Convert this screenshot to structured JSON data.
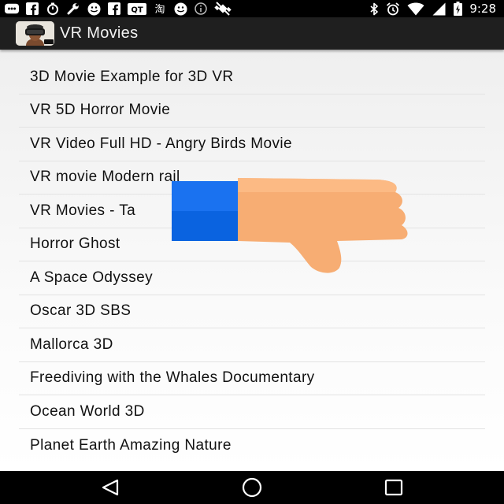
{
  "status_bar": {
    "time": "9:28",
    "left_icons": [
      "chat-icon",
      "facebook-icon",
      "stopwatch-icon",
      "wrench-icon",
      "smiley-icon",
      "facebook-icon",
      "qt-icon",
      "taobao-icon",
      "smiley-icon",
      "info-icon",
      "no-satellite-icon"
    ],
    "right_icons": [
      "bluetooth-icon",
      "alarm-icon",
      "wifi-icon",
      "signal-icon",
      "battery-charging-icon"
    ],
    "left_labels": {
      "qt": "QT",
      "taobao": "淘"
    }
  },
  "app_bar": {
    "title": "VR Movies",
    "icon": "vr-headset-app-icon"
  },
  "movies": [
    "3D Movie Example for 3D VR",
    "VR 5D Horror Movie",
    "VR Video Full HD - Angry Birds Movie",
    "VR movie Modern rail",
    "VR Movies - Ta",
    "Horror Ghost",
    "A Space Odyssey",
    "Oscar 3D SBS",
    "Mallorca 3D",
    "Freediving with the Whales Documentary",
    "Ocean World 3D",
    "Planet Earth Amazing Nature"
  ],
  "overlay": {
    "icon": "thumbs-down-icon",
    "colors": {
      "cuff": "#0a63e0",
      "hand": "#f5b07a"
    }
  },
  "nav_bar": {
    "buttons": [
      "back-icon",
      "home-icon",
      "recents-icon"
    ]
  }
}
